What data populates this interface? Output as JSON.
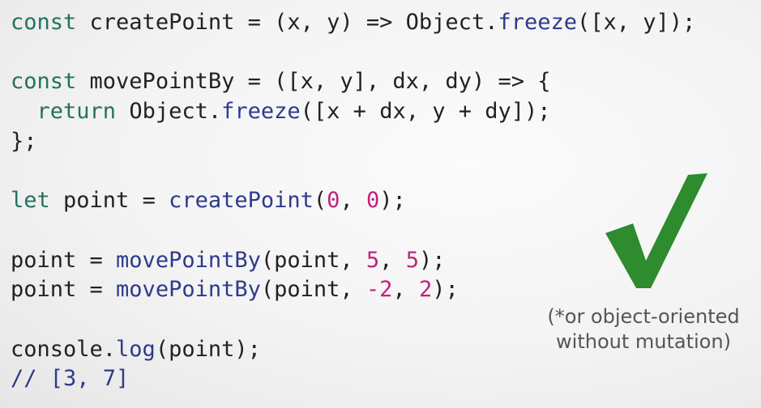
{
  "code": {
    "lines": [
      [
        {
          "t": "const",
          "c": "kw"
        },
        {
          "t": " createPoint = (x, y) => Object.",
          "c": "plain"
        },
        {
          "t": "freeze",
          "c": "fn"
        },
        {
          "t": "([x, y]);",
          "c": "plain"
        }
      ],
      [],
      [
        {
          "t": "const",
          "c": "kw"
        },
        {
          "t": " movePointBy = ([x, y], dx, dy) => {",
          "c": "plain"
        }
      ],
      [
        {
          "t": "  ",
          "c": "plain"
        },
        {
          "t": "return",
          "c": "kw"
        },
        {
          "t": " Object.",
          "c": "plain"
        },
        {
          "t": "freeze",
          "c": "fn"
        },
        {
          "t": "([x + dx, y + dy]);",
          "c": "plain"
        }
      ],
      [
        {
          "t": "};",
          "c": "plain"
        }
      ],
      [],
      [
        {
          "t": "let",
          "c": "kw"
        },
        {
          "t": " point = ",
          "c": "plain"
        },
        {
          "t": "createPoint",
          "c": "fn"
        },
        {
          "t": "(",
          "c": "plain"
        },
        {
          "t": "0",
          "c": "num"
        },
        {
          "t": ", ",
          "c": "plain"
        },
        {
          "t": "0",
          "c": "num"
        },
        {
          "t": ");",
          "c": "plain"
        }
      ],
      [],
      [
        {
          "t": "point = ",
          "c": "plain"
        },
        {
          "t": "movePointBy",
          "c": "fn"
        },
        {
          "t": "(point, ",
          "c": "plain"
        },
        {
          "t": "5",
          "c": "num"
        },
        {
          "t": ", ",
          "c": "plain"
        },
        {
          "t": "5",
          "c": "num"
        },
        {
          "t": ");",
          "c": "plain"
        }
      ],
      [
        {
          "t": "point = ",
          "c": "plain"
        },
        {
          "t": "movePointBy",
          "c": "fn"
        },
        {
          "t": "(point, ",
          "c": "plain"
        },
        {
          "t": "-2",
          "c": "num"
        },
        {
          "t": ", ",
          "c": "plain"
        },
        {
          "t": "2",
          "c": "num"
        },
        {
          "t": ");",
          "c": "plain"
        }
      ],
      [],
      [
        {
          "t": "console.",
          "c": "plain"
        },
        {
          "t": "log",
          "c": "fn"
        },
        {
          "t": "(point);",
          "c": "plain"
        }
      ],
      [
        {
          "t": "// [3, 7]",
          "c": "cm"
        }
      ]
    ]
  },
  "note": {
    "line1": "(*or object-oriented",
    "line2": "without mutation)"
  },
  "colors": {
    "keyword": "#23725e",
    "function": "#2d3a8c",
    "number": "#c0227b",
    "checkmark": "#2e8b2e"
  },
  "icons": {
    "check": "checkmark-icon"
  }
}
